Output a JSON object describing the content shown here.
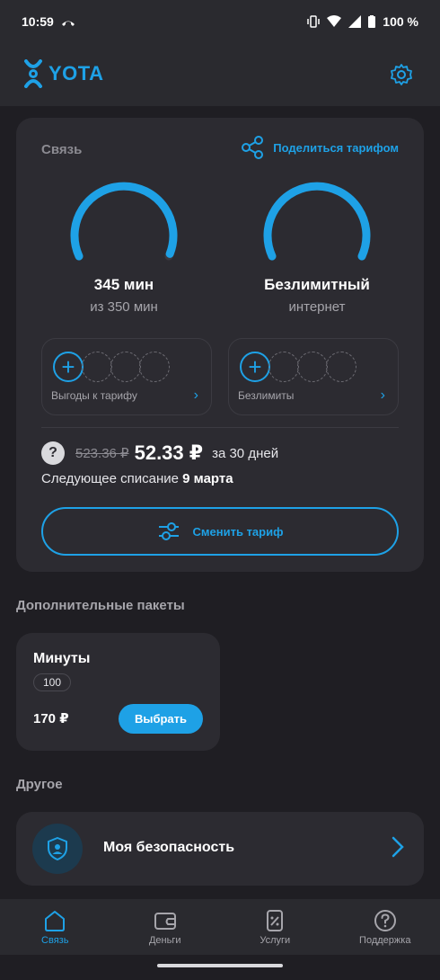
{
  "status_bar": {
    "time": "10:59",
    "battery": "100 %"
  },
  "header": {
    "brand": "YOTA"
  },
  "plan": {
    "section_title": "Связь",
    "share_label": "Поделиться тарифом",
    "minutes": {
      "value": "345 мин",
      "sub": "из 350 мин",
      "fraction_remaining": 0.986
    },
    "internet": {
      "value": "Безлимитный",
      "sub": "интернет",
      "fraction_remaining": 1.0
    },
    "benefits_label": "Выгоды к тарифу",
    "unlimited_label": "Безлимиты",
    "old_price": "523.36 ₽",
    "new_price": "52.33 ₽",
    "period": "за 30 дней",
    "next_charge_prefix": "Следующее списание",
    "next_charge_date": "9 марта",
    "change_button": "Сменить тариф"
  },
  "extra_packages": {
    "title": "Дополнительные пакеты",
    "card": {
      "title": "Минуты",
      "amount": "100",
      "price": "170 ₽",
      "button": "Выбрать"
    }
  },
  "other": {
    "title": "Другое",
    "security_label": "Моя безопасность"
  },
  "nav": [
    {
      "label": "Связь",
      "icon": "home-icon",
      "active": true
    },
    {
      "label": "Деньги",
      "icon": "wallet-icon",
      "active": false
    },
    {
      "label": "Услуги",
      "icon": "percent-doc-icon",
      "active": false
    },
    {
      "label": "Поддержка",
      "icon": "help-icon",
      "active": false
    }
  ],
  "colors": {
    "accent": "#1ea1e6",
    "background": "#1f1e23",
    "card": "#2c2b31"
  }
}
